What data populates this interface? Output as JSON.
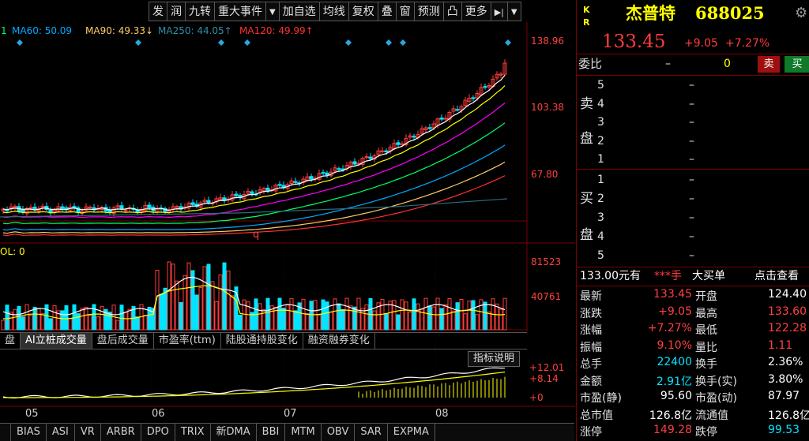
{
  "toolbar": {
    "items": [
      "发",
      "润",
      "九转",
      "重大事件",
      "▼",
      "加自选",
      "均线",
      "复权",
      "叠",
      "窗",
      "预测",
      "凸",
      "更多",
      "▶|",
      "▼"
    ]
  },
  "ma_legend": {
    "ma1": "1",
    "ma60": "MA60: 50.09",
    "ma90": "MA90: 49.33↓",
    "ma250": "MA250: 44.05↑",
    "ma120": "MA120: 49.99↑"
  },
  "price_axis": {
    "p1": "138.96",
    "p2": "103.38",
    "p3": "67.80"
  },
  "vol_panel": {
    "label": "OL: 0",
    "v1": "81523",
    "v2": "40761"
  },
  "marker_q": "q",
  "tabs": [
    "盘",
    "AI立桩成交量",
    "盘后成交量",
    "市盈率(ttm)",
    "陆股通持股变化",
    "融资融券变化"
  ],
  "indicator": {
    "button": "指标说明",
    "v1": "+12.01",
    "v2": "+8.14",
    "v3": "+0"
  },
  "months": [
    "05",
    "06",
    "07",
    "08"
  ],
  "bottom_tabs": [
    "",
    "BIAS",
    "ASI",
    "VR",
    "ARBR",
    "DPO",
    "TRIX",
    "新DMA",
    "BBI",
    "MTM",
    "OBV",
    "SAR",
    "EXPMA"
  ],
  "quote": {
    "kr1": "K",
    "kr2": "R",
    "name": "杰普特",
    "code": "688025",
    "price": "133.45",
    "change": "+9.05",
    "pct": "+7.27%",
    "weibi": "委比",
    "weibi_dash": "–",
    "weibi_val": "0",
    "sell_btn": "卖",
    "buy_btn": "买"
  },
  "orderbook": {
    "sell_label_1": "卖",
    "sell_label_2": "盘",
    "buy_label_1": "买",
    "buy_label_2": "盘",
    "sell": [
      {
        "lvl": "5",
        "v": "–"
      },
      {
        "lvl": "4",
        "v": "–"
      },
      {
        "lvl": "3",
        "v": "–"
      },
      {
        "lvl": "2",
        "v": "–"
      },
      {
        "lvl": "1",
        "v": "–"
      }
    ],
    "buy": [
      {
        "lvl": "1",
        "v": "–"
      },
      {
        "lvl": "2",
        "v": "–"
      },
      {
        "lvl": "3",
        "v": "–"
      },
      {
        "lvl": "4",
        "v": "–"
      },
      {
        "lvl": "5",
        "v": "–"
      }
    ]
  },
  "bigbuy": {
    "price": "133.00元有",
    "hands": "***手",
    "tag": "大买单",
    "link": "点击查看"
  },
  "stats": [
    {
      "l1": "最新",
      "v1": "133.45",
      "c1": "up",
      "l2": "开盘",
      "v2": "124.40",
      "c2": "wt"
    },
    {
      "l1": "涨跌",
      "v1": "+9.05",
      "c1": "up",
      "l2": "最高",
      "v2": "133.60",
      "c2": "up"
    },
    {
      "l1": "涨幅",
      "v1": "+7.27%",
      "c1": "up",
      "l2": "最低",
      "v2": "122.28",
      "c2": "up"
    },
    {
      "l1": "振幅",
      "v1": "9.10%",
      "c1": "up",
      "l2": "量比",
      "v2": "1.11",
      "c2": "up"
    },
    {
      "l1": "总手",
      "v1": "22400",
      "c1": "cy",
      "l2": "换手",
      "v2": "2.36%",
      "c2": "wt"
    },
    {
      "l1": "金额",
      "v1": "2.91亿",
      "c1": "cy",
      "l2": "换手(实)",
      "v2": "3.80%",
      "c2": "wt"
    },
    {
      "l1": "市盈(静)",
      "v1": "95.60",
      "c1": "wt",
      "l2": "市盈(动)",
      "v2": "87.97",
      "c2": "wt"
    },
    {
      "l1": "总市值",
      "v1": "126.8亿",
      "c1": "wt",
      "l2": "流通值",
      "v2": "126.8亿",
      "c2": "wt"
    },
    {
      "l1": "涨停",
      "v1": "149.28",
      "c1": "up",
      "l2": "跌停",
      "v2": "99.53",
      "c2": "cy"
    }
  ],
  "colors": {
    "up": "#ff3b3b",
    "down": "#00e5ff",
    "ma5": "#ffffff",
    "ma10": "#ffff00",
    "ma20": "#ff00ff",
    "ma30": "#00ff66",
    "ma60": "#00aaff",
    "ma90": "#ffcc66",
    "ma120": "#ff3030",
    "ma250": "#2f6b7a"
  }
}
